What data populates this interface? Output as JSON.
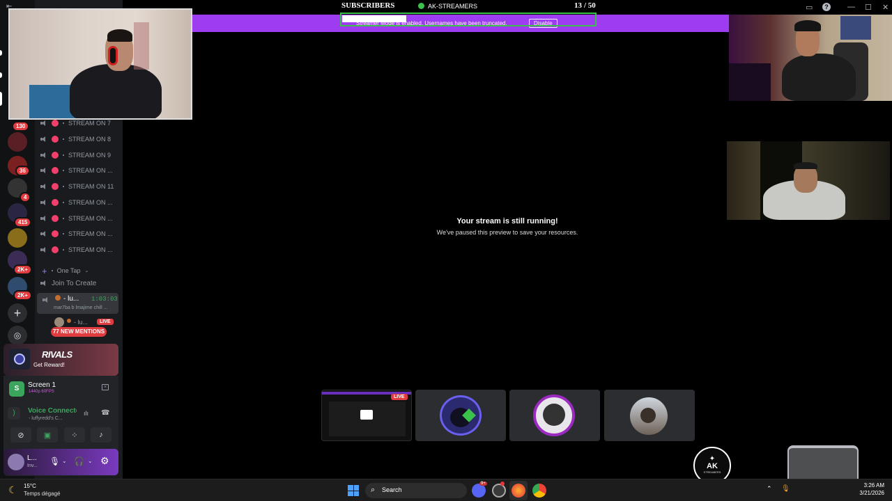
{
  "overlay": {
    "subscribers_label": "SUBSCRIBERS",
    "channel_name": "AK-STREAMERS",
    "sub_count": "13",
    "sub_goal": "/ 50",
    "banner_text": "Streamer Mode is enabled. Usernames have been truncated.",
    "disable_label": "Disable"
  },
  "rail": {
    "badges": [
      "130",
      "36",
      "4",
      "415",
      "2K+",
      "2K+"
    ]
  },
  "channels": {
    "stream_rooms": [
      "STREAM ON 7",
      "STREAM ON 8",
      "STREAM ON 9",
      "STREAM ON ...",
      "STREAM ON 11",
      "STREAM ON ...",
      "STREAM ON ...",
      "STREAM ON ...",
      "STREAM ON ..."
    ],
    "category_label": "One Tap",
    "join_label": "Join To Create",
    "active_user": "- lu...",
    "active_time": "1:03:03",
    "active_status": "mar7ba b lmajime chill ...",
    "second_user": "- lu...",
    "live_badge": "LIVE",
    "mentions": "77 NEW MENTIONS"
  },
  "promo": {
    "brand": "RIVALS",
    "cta": "Get Reward!"
  },
  "screen_share": {
    "title": "Screen 1",
    "quality": "1440p 60FPS"
  },
  "voice": {
    "status": "Voice Connected",
    "channel": "- luffyredd's C..."
  },
  "user": {
    "name": "L...",
    "status": "Inv..."
  },
  "stage": {
    "title": "Your stream is still running!",
    "subtitle": "We've paused this preview to save your resources.",
    "tile_live": "LIVE"
  },
  "logo": {
    "text": "AK",
    "subtext": "STREAMERS"
  },
  "taskbar": {
    "temp": "15°C",
    "weather": "Temps dégagé",
    "search": "Search",
    "time": "3:26 AM",
    "date": "3/21/2026",
    "discord_badge": "9+"
  },
  "colors": {
    "banner": "#9d3cf0",
    "frame": "#3ac24b",
    "live": "#e03b3f",
    "discord_bg": "#1a1b1e"
  }
}
